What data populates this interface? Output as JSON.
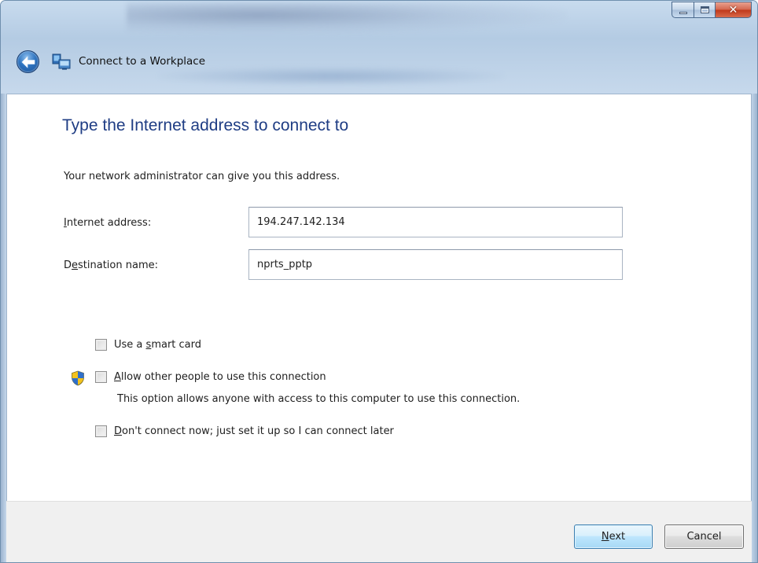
{
  "window": {
    "title": "Connect to a Workplace",
    "caption": {
      "minimize_icon": "minimize-icon",
      "maximize_icon": "maximize-icon",
      "close_icon": "close-icon"
    }
  },
  "colors": {
    "heading": "#1f3d84",
    "frame": "#b9cfe4",
    "close_button": "#c0381a",
    "default_button_border": "#3c7fb1"
  },
  "page": {
    "heading": "Type the Internet address to connect to",
    "intro": "Your network administrator can give you this address."
  },
  "fields": {
    "internet_address": {
      "label_pre": "",
      "label_key": "I",
      "label_post": "nternet address:",
      "value": "194.247.142.134"
    },
    "destination_name": {
      "label_pre": "D",
      "label_key": "e",
      "label_post": "stination name:",
      "value": "nprts_pptp"
    }
  },
  "options": {
    "smart_card": {
      "pre": "Use a ",
      "key": "s",
      "post": "mart card",
      "checked": false
    },
    "allow_others": {
      "pre": "",
      "key": "A",
      "post": "llow other people to use this connection",
      "checked": false,
      "note": "This option allows anyone with access to this computer to use this connection.",
      "icon": "uac-shield-icon"
    },
    "connect_later": {
      "pre": "",
      "key": "D",
      "post": "on't connect now; just set it up so I can connect later",
      "checked": false
    }
  },
  "buttons": {
    "next": {
      "key": "N",
      "post": "ext"
    },
    "cancel": {
      "label": "Cancel"
    }
  },
  "icons": {
    "back": "back-arrow-icon",
    "app": "network-connection-icon"
  }
}
